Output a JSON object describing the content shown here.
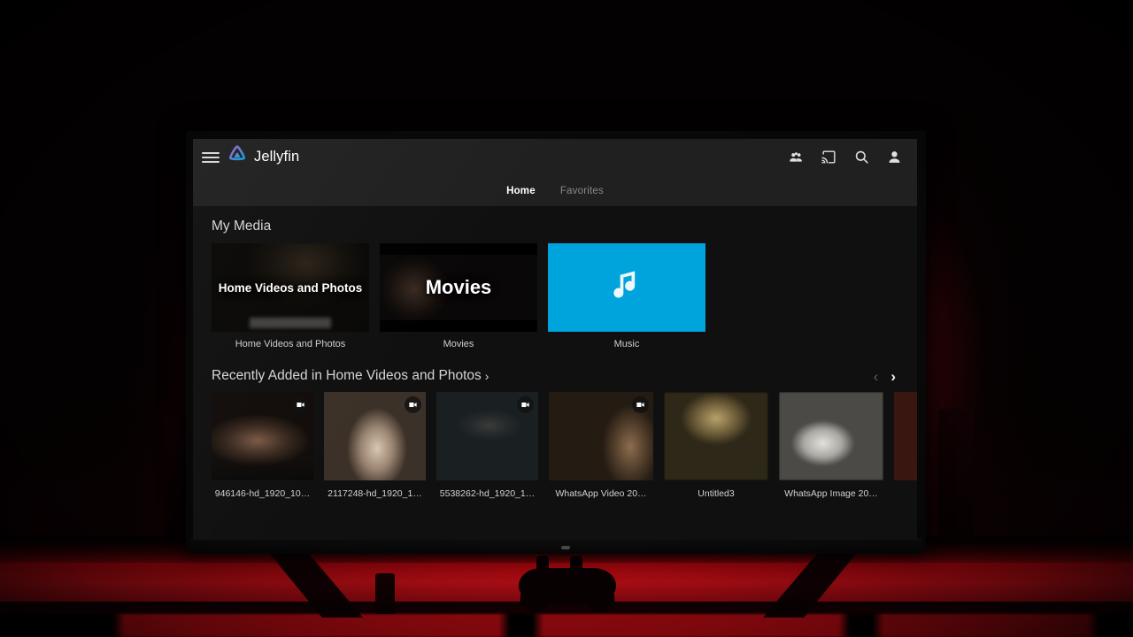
{
  "app": {
    "brand_name": "Jellyfin",
    "logo_icon": "jellyfin-logo-icon",
    "menu_icon": "hamburger-menu-icon"
  },
  "header": {
    "icons": [
      {
        "name": "group-icon",
        "label": "Groups"
      },
      {
        "name": "cast-icon",
        "label": "Cast"
      },
      {
        "name": "search-icon",
        "label": "Search"
      },
      {
        "name": "account-icon",
        "label": "Account"
      }
    ]
  },
  "tabs": [
    {
      "label": "Home",
      "active": true
    },
    {
      "label": "Favorites",
      "active": false
    }
  ],
  "my_media": {
    "title": "My Media",
    "cards": [
      {
        "overlay_text": "Home Videos and Photos",
        "label": "Home Videos and Photos",
        "style": "hvp",
        "art": "img-hvp"
      },
      {
        "overlay_text": "Movies",
        "label": "Movies",
        "style": "mov",
        "art": "img-mov"
      },
      {
        "overlay_text": "",
        "label": "Music",
        "style": "mus",
        "art": "img-music",
        "icon": "music-note-icon"
      }
    ]
  },
  "recently_added": {
    "title": "Recently Added in Home Videos and Photos",
    "title_chevron": "›",
    "prev_arrow": "‹",
    "next_arrow": "›",
    "prev_enabled": false,
    "next_enabled": true,
    "items": [
      {
        "label": "946146-hd_1920_10…",
        "art": "img-typing",
        "badge": "video-camera-icon",
        "is_video": true
      },
      {
        "label": "2117248-hd_1920_1…",
        "art": "img-walk",
        "badge": "video-camera-icon",
        "is_video": true
      },
      {
        "label": "5538262-hd_1920_1…",
        "art": "img-water",
        "badge": "video-camera-icon",
        "is_video": true
      },
      {
        "label": "WhatsApp Video 20…",
        "art": "img-street",
        "badge": "video-camera-icon",
        "is_video": true
      },
      {
        "label": "Untitled3",
        "art": "img-untitled",
        "badge": "",
        "is_video": false
      },
      {
        "label": "WhatsApp Image 20…",
        "art": "img-wimage",
        "badge": "",
        "is_video": false
      },
      {
        "label": "",
        "art": "img-cut",
        "badge": "",
        "is_video": false
      }
    ]
  },
  "colors": {
    "brand_blue": "#00A4DC",
    "appbar_bg": "#202020",
    "content_bg": "#101010",
    "accent_red_glow": "#E80C16",
    "logo_gradient_start": "#AA5CC3",
    "logo_gradient_end": "#00A4DC"
  },
  "scene": {
    "description": "Television displaying Jellyfin interface in a dark room with red LED ambient lighting",
    "objects": [
      "tv",
      "tv-stand",
      "game-controller",
      "speaker-left",
      "speaker-right",
      "desk"
    ]
  }
}
